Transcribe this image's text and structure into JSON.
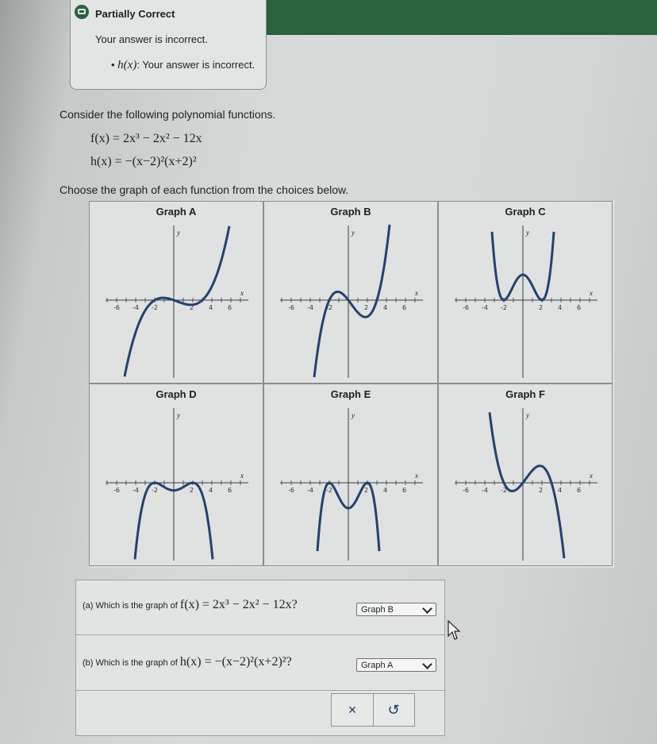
{
  "status": {
    "title": "Partially Correct",
    "message": "Your answer is incorrect.",
    "detail_fn": "h(x)",
    "detail_text": ": Your answer is incorrect."
  },
  "problem": {
    "intro": "Consider the following polynomial functions.",
    "f": "f(x) = 2x³ − 2x² − 12x",
    "h": "h(x) = −(x−2)²(x+2)²",
    "instruction": "Choose the graph of each function from the choices below."
  },
  "graphs": {
    "A": "Graph A",
    "B": "Graph B",
    "C": "Graph C",
    "D": "Graph D",
    "E": "Graph E",
    "F": "Graph F",
    "x_ticks": [
      "-6",
      "-4",
      "-2",
      "2",
      "4",
      "6"
    ],
    "x_label": "x",
    "y_label": "y"
  },
  "questions": {
    "a_label": "(a)",
    "a_text": "Which is the graph of",
    "a_math": "f(x) = 2x³ − 2x² − 12x?",
    "a_selected": "Graph B",
    "b_label": "(b)",
    "b_text": "Which is the graph of",
    "b_math": "h(x) = −(x−2)²(x+2)²?",
    "b_selected": "Graph A"
  },
  "buttons": {
    "clear": "×",
    "undo": "↺"
  },
  "colors": {
    "accent": "#28623e",
    "curve": "#25426e"
  }
}
